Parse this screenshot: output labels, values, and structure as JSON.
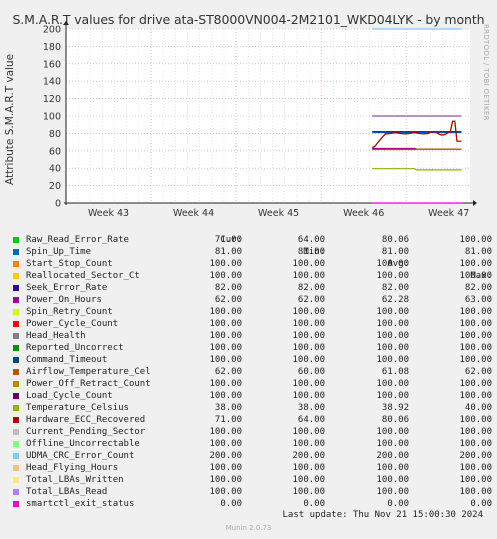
{
  "title": "S.M.A.R.T values for drive ata-ST8000VN004-2M2101_WKD04LYK - by month",
  "watermark": "RRDTOOL / TOBI OETIKER",
  "footer": "Munin 2.0.73",
  "last_update": "Last update: Thu Nov 21 15:00:30 2024",
  "colors": {
    "background": "#f0f0f0",
    "plot": "#ffffff",
    "grid": "#e0a0a0",
    "axis": "#222222"
  },
  "legend_headers": {
    "cur": "Cur:",
    "min": "Min:",
    "avg": "Avg:",
    "max": "Max:"
  },
  "chart_data": {
    "type": "line",
    "title": "S.M.A.R.T values for drive ata-ST8000VN004-2M2101_WKD04LYK - by month",
    "xlabel": "",
    "ylabel": "Attribute S.M.A.R.T value",
    "x_ticks": [
      "Week 43",
      "Week 44",
      "Week 45",
      "Week 46",
      "Week 47"
    ],
    "y_ticks": [
      "0",
      "20",
      "40",
      "60",
      "80",
      "100",
      "120",
      "140",
      "160",
      "180",
      "200"
    ],
    "ylim": [
      0,
      200
    ],
    "xlim": [
      42.5,
      47.25
    ],
    "data_start": 46.1,
    "data_end": 47.15,
    "grid": true,
    "series": [
      {
        "name": "Raw_Read_Error_Rate",
        "color": "#00cc00",
        "cur": "71.00",
        "min": "64.00",
        "avg": "80.06",
        "max": "100.00"
      },
      {
        "name": "Spin_Up_Time",
        "color": "#0066b3",
        "cur": "81.00",
        "min": "81.00",
        "avg": "81.00",
        "max": "81.00"
      },
      {
        "name": "Start_Stop_Count",
        "color": "#ff8000",
        "cur": "100.00",
        "min": "100.00",
        "avg": "100.00",
        "max": "100.00"
      },
      {
        "name": "Reallocated_Sector_Ct",
        "color": "#ffcc00",
        "cur": "100.00",
        "min": "100.00",
        "avg": "100.00",
        "max": "100.00"
      },
      {
        "name": "Seek_Error_Rate",
        "color": "#330099",
        "cur": "82.00",
        "min": "82.00",
        "avg": "82.00",
        "max": "82.00"
      },
      {
        "name": "Power_On_Hours",
        "color": "#990099",
        "cur": "62.00",
        "min": "62.00",
        "avg": "62.28",
        "max": "63.00"
      },
      {
        "name": "Spin_Retry_Count",
        "color": "#ccff00",
        "cur": "100.00",
        "min": "100.00",
        "avg": "100.00",
        "max": "100.00"
      },
      {
        "name": "Power_Cycle_Count",
        "color": "#ff0000",
        "cur": "100.00",
        "min": "100.00",
        "avg": "100.00",
        "max": "100.00"
      },
      {
        "name": "Head_Health",
        "color": "#808080",
        "cur": "100.00",
        "min": "100.00",
        "avg": "100.00",
        "max": "100.00"
      },
      {
        "name": "Reported_Uncorrect",
        "color": "#008f00",
        "cur": "100.00",
        "min": "100.00",
        "avg": "100.00",
        "max": "100.00"
      },
      {
        "name": "Command_Timeout",
        "color": "#00487d",
        "cur": "100.00",
        "min": "100.00",
        "avg": "100.00",
        "max": "100.00"
      },
      {
        "name": "Airflow_Temperature_Cel",
        "color": "#b35a00",
        "cur": "62.00",
        "min": "60.00",
        "avg": "61.08",
        "max": "62.00"
      },
      {
        "name": "Power_Off_Retract_Count",
        "color": "#b38f00",
        "cur": "100.00",
        "min": "100.00",
        "avg": "100.00",
        "max": "100.00"
      },
      {
        "name": "Load_Cycle_Count",
        "color": "#6b006b",
        "cur": "100.00",
        "min": "100.00",
        "avg": "100.00",
        "max": "100.00"
      },
      {
        "name": "Temperature_Celsius",
        "color": "#8fb300",
        "cur": "38.00",
        "min": "38.00",
        "avg": "38.92",
        "max": "40.00"
      },
      {
        "name": "Hardware_ECC_Recovered",
        "color": "#b30000",
        "cur": "71.00",
        "min": "64.00",
        "avg": "80.06",
        "max": "100.00"
      },
      {
        "name": "Current_Pending_Sector",
        "color": "#bebebe",
        "cur": "100.00",
        "min": "100.00",
        "avg": "100.00",
        "max": "100.00"
      },
      {
        "name": "Offline_Uncorrectable",
        "color": "#80ff80",
        "cur": "100.00",
        "min": "100.00",
        "avg": "100.00",
        "max": "100.00"
      },
      {
        "name": "UDMA_CRC_Error_Count",
        "color": "#80c9ff",
        "cur": "200.00",
        "min": "200.00",
        "avg": "200.00",
        "max": "200.00"
      },
      {
        "name": "Head_Flying_Hours",
        "color": "#ffc080",
        "cur": "100.00",
        "min": "100.00",
        "avg": "100.00",
        "max": "100.00"
      },
      {
        "name": "Total_LBAs_Written",
        "color": "#ffe680",
        "cur": "100.00",
        "min": "100.00",
        "avg": "100.00",
        "max": "100.00"
      },
      {
        "name": "Total_LBAs_Read",
        "color": "#aa80ff",
        "cur": "100.00",
        "min": "100.00",
        "avg": "100.00",
        "max": "100.00"
      },
      {
        "name": "smartctl_exit_status",
        "color": "#ee00cc",
        "cur": "0.00",
        "min": "0.00",
        "avg": "0.00",
        "max": "0.00"
      }
    ]
  }
}
